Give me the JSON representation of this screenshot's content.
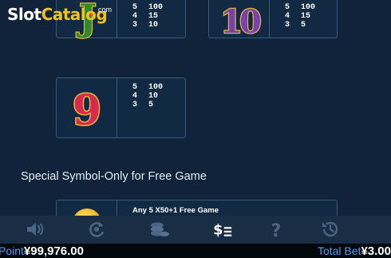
{
  "watermark": {
    "brand_a": "Slot",
    "brand_b": "Catalog",
    "suffix": "com"
  },
  "paytable": {
    "symbols": [
      {
        "name": "J",
        "pays": [
          {
            "count": "5",
            "payout": "100"
          },
          {
            "count": "4",
            "payout": "15"
          },
          {
            "count": "3",
            "payout": "10"
          }
        ]
      },
      {
        "name": "10",
        "pays": [
          {
            "count": "5",
            "payout": "100"
          },
          {
            "count": "4",
            "payout": "15"
          },
          {
            "count": "3",
            "payout": "5"
          }
        ]
      },
      {
        "name": "9",
        "pays": [
          {
            "count": "5",
            "payout": "100"
          },
          {
            "count": "4",
            "payout": "10"
          },
          {
            "count": "3",
            "payout": "5"
          }
        ]
      }
    ],
    "special_title": "Special Symbol-Only for Free Game",
    "special": {
      "icon": "gold-coin-icon",
      "description": "Any 5  X50+1 Free Game"
    }
  },
  "toolbar": {
    "icons": [
      "sound-icon",
      "autoplay-icon",
      "chips-icon",
      "paytable-icon",
      "help-icon",
      "history-icon"
    ],
    "active": "paytable-icon"
  },
  "status": {
    "point_label": "Point",
    "point_value": "¥99,976.00",
    "bet_label": "Total Bet",
    "bet_value": "¥3.00"
  },
  "colors": {
    "background": "#10233a",
    "card_border": "#39597b",
    "label_blue": "#4d9cf0",
    "watermark_gold": "#f3c21b"
  }
}
